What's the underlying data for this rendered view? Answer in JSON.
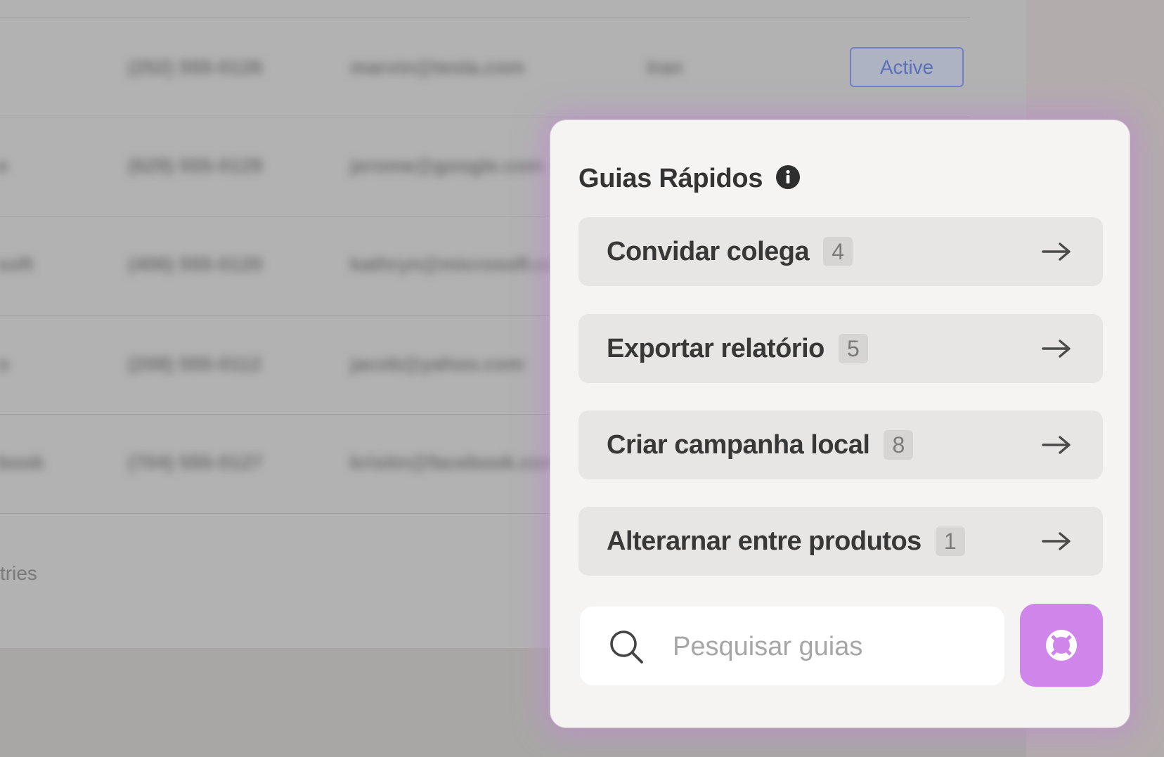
{
  "background_table": {
    "rows": [
      {
        "company": "",
        "phone": "(252) 555-0126",
        "email": "marvin@tesla.com",
        "country": "Iran",
        "status": "Active"
      },
      {
        "company": "e",
        "phone": "(629) 555-0129",
        "email": "jerome@google.com",
        "country": "",
        "status": ""
      },
      {
        "company": "soft",
        "phone": "(406) 555-0120",
        "email": "kathryn@microsoft.com",
        "country": "",
        "status": ""
      },
      {
        "company": "o",
        "phone": "(208) 555-0112",
        "email": "jacob@yahoo.com",
        "country": "",
        "status": ""
      },
      {
        "company": "book",
        "phone": "(704) 555-0127",
        "email": "kristin@facebook.com",
        "country": "",
        "status": ""
      }
    ],
    "footer_text": "tries"
  },
  "quick_guides": {
    "title": "Guias Rápidos",
    "info_icon": "info-circle-icon",
    "items": [
      {
        "label": "Convidar colega",
        "count": "4"
      },
      {
        "label": "Exportar relatório",
        "count": "5"
      },
      {
        "label": "Criar campanha local",
        "count": "8"
      },
      {
        "label": "Alterarnar entre produtos",
        "count": "1"
      }
    ],
    "search": {
      "placeholder": "Pesquisar guias",
      "value": ""
    },
    "help_button_icon": "lifebuoy-icon"
  },
  "colors": {
    "accent": "#cf85ea",
    "badge_blue": "#5b70b8",
    "panel_bg": "#f5f4f2",
    "item_bg": "#e7e6e5"
  }
}
